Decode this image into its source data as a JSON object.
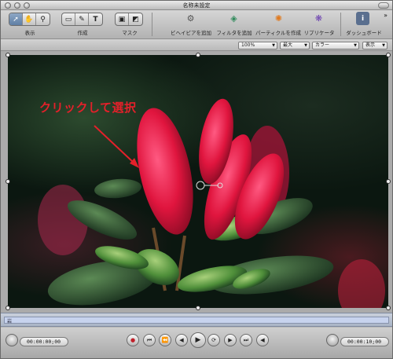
{
  "window": {
    "title": "名称未設定"
  },
  "toolbar": {
    "view_label": "表示",
    "create_label": "作成",
    "mask_label": "マスク",
    "actions": [
      {
        "label": "ビヘイビアを追加",
        "icon": "behavior-gear-icon"
      },
      {
        "label": "フィルタを追加",
        "icon": "filter-icon"
      },
      {
        "label": "パーティクルを作成",
        "icon": "particle-icon"
      },
      {
        "label": "リプリケータ",
        "icon": "replicator-icon"
      },
      {
        "label": "ダッシュボード",
        "icon": "dashboard-info-icon"
      }
    ]
  },
  "options": {
    "zoom": "100%",
    "quality": "最大",
    "channels": "カラー",
    "view": "表示"
  },
  "canvas": {
    "annotation": "クリックして選択",
    "annotation_color": "#e4202a"
  },
  "timeline": {
    "label": "岩"
  },
  "transport": {
    "current_time": "00:00:00;00",
    "duration": "00:00:10;00"
  }
}
